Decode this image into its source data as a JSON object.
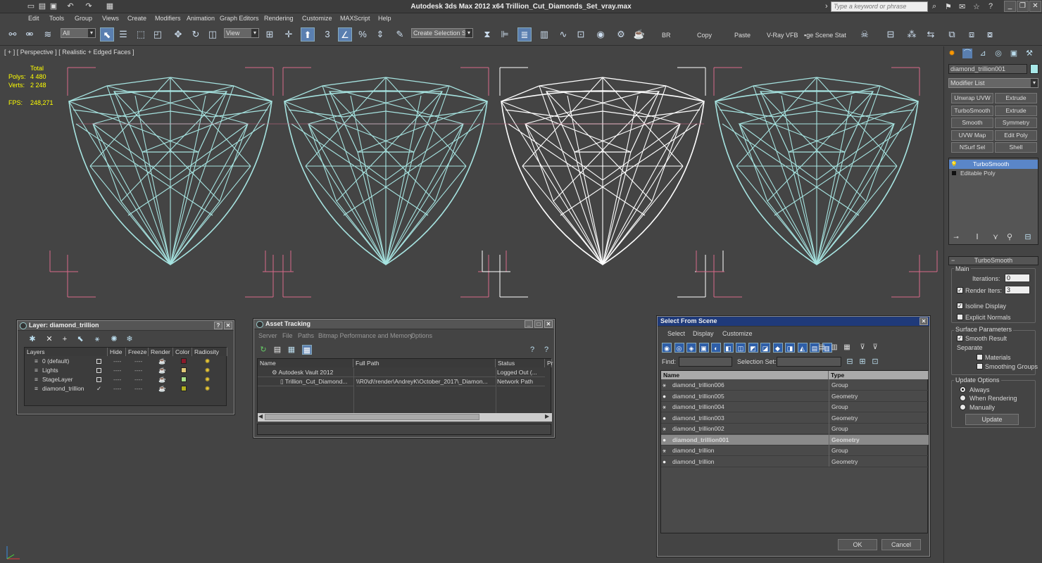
{
  "window": {
    "title": "Autodesk 3ds Max  2012 x64     Trillion_Cut_Diamonds_Set_vray.max",
    "search_placeholder": "Type a keyword or phrase"
  },
  "menu": [
    "Edit",
    "Tools",
    "Group",
    "Views",
    "Create",
    "Modifiers",
    "Animation",
    "Graph Editors",
    "Rendering",
    "Customize",
    "MAXScript",
    "Help"
  ],
  "toolbar": {
    "filter": "All",
    "ref_coord": "View",
    "snap_3": "3",
    "named_sel": "Create Selection Se",
    "text_buttons": [
      "BR",
      "Copy",
      "Paste",
      "V-Ray VFB",
      "ge Scene Stat"
    ]
  },
  "viewport": {
    "label": "[ + ] [ Perspective ] [ Realistic + Edged Faces ]",
    "stats": {
      "total_label": "Total",
      "polys_label": "Polys:",
      "polys": "4 480",
      "verts_label": "Verts:",
      "verts": "2 248",
      "fps_label": "FPS:",
      "fps": "248,271"
    },
    "colors": {
      "wire": "#a6e3e0",
      "selected": "#ffffff",
      "bracket": "#d86a8a"
    }
  },
  "layer_panel": {
    "title": "Layer: diamond_trillion",
    "columns": [
      "Layers",
      "Hide",
      "Freeze",
      "Render",
      "Color",
      "Radiosity"
    ],
    "rows": [
      {
        "name": "0 (default)",
        "color": "#8b1a2b"
      },
      {
        "name": "Lights",
        "color": "#e0c878"
      },
      {
        "name": "StageLayer",
        "color": "#a8e088"
      },
      {
        "name": "diamond_trillion",
        "color": "#b0b020"
      }
    ]
  },
  "asset_panel": {
    "title": "Asset Tracking",
    "menu": [
      "Server",
      "File",
      "Paths",
      "Bitmap Performance and Memory",
      "Options"
    ],
    "columns": [
      "Name",
      "Full Path",
      "Status",
      "Pr"
    ],
    "rows": [
      {
        "name": "Autodesk Vault 2012",
        "path": "",
        "status": "Logged Out (..."
      },
      {
        "name": "Trillion_Cut_Diamond...",
        "path": "\\\\R0\\d\\!render\\AndreyK\\October_2017\\_Diamon...",
        "status": "Network Path"
      }
    ]
  },
  "select_panel": {
    "title": "Select From Scene",
    "menu": [
      "Select",
      "Display",
      "Customize"
    ],
    "find_label": "Find:",
    "selset_label": "Selection Set:",
    "columns": [
      "Name",
      "Type"
    ],
    "rows": [
      {
        "name": "diamond_trillion006",
        "type": "Group",
        "selected": false
      },
      {
        "name": "diamond_trillion005",
        "type": "Geometry",
        "selected": false
      },
      {
        "name": "diamond_trillion004",
        "type": "Group",
        "selected": false
      },
      {
        "name": "diamond_trillion003",
        "type": "Geometry",
        "selected": false
      },
      {
        "name": "diamond_trillion002",
        "type": "Group",
        "selected": false
      },
      {
        "name": "diamond_trillion001",
        "type": "Geometry",
        "selected": true
      },
      {
        "name": "diamond_trillion",
        "type": "Group",
        "selected": false
      },
      {
        "name": "diamond_trillion",
        "type": "Geometry",
        "selected": false
      }
    ],
    "ok": "OK",
    "cancel": "Cancel"
  },
  "command_panel": {
    "object_name": "diamond_trillion001",
    "modifier_list": "Modifier List",
    "buttons": [
      "Unwrap UVW",
      "Extrude",
      "TurboSmooth",
      "Extrude",
      "Smooth",
      "Symmetry",
      "UVW Map",
      "Edit Poly",
      "NSurf Sel",
      "Shell"
    ],
    "stack": [
      "TurboSmooth",
      "Editable Poly"
    ],
    "rollout": {
      "title": "TurboSmooth",
      "main": "Main",
      "iterations_label": "Iterations:",
      "iterations": "0",
      "render_iters_label": "Render Iters:",
      "render_iters": "3",
      "isoline": "Isoline Display",
      "explicit": "Explicit Normals",
      "surface": "Surface Parameters",
      "smooth_result": "Smooth Result",
      "separate": "Separate",
      "materials": "Materials",
      "smoothing_groups": "Smoothing Groups",
      "update_options": "Update Options",
      "always": "Always",
      "when_rendering": "When Rendering",
      "manually": "Manually",
      "update": "Update"
    }
  }
}
